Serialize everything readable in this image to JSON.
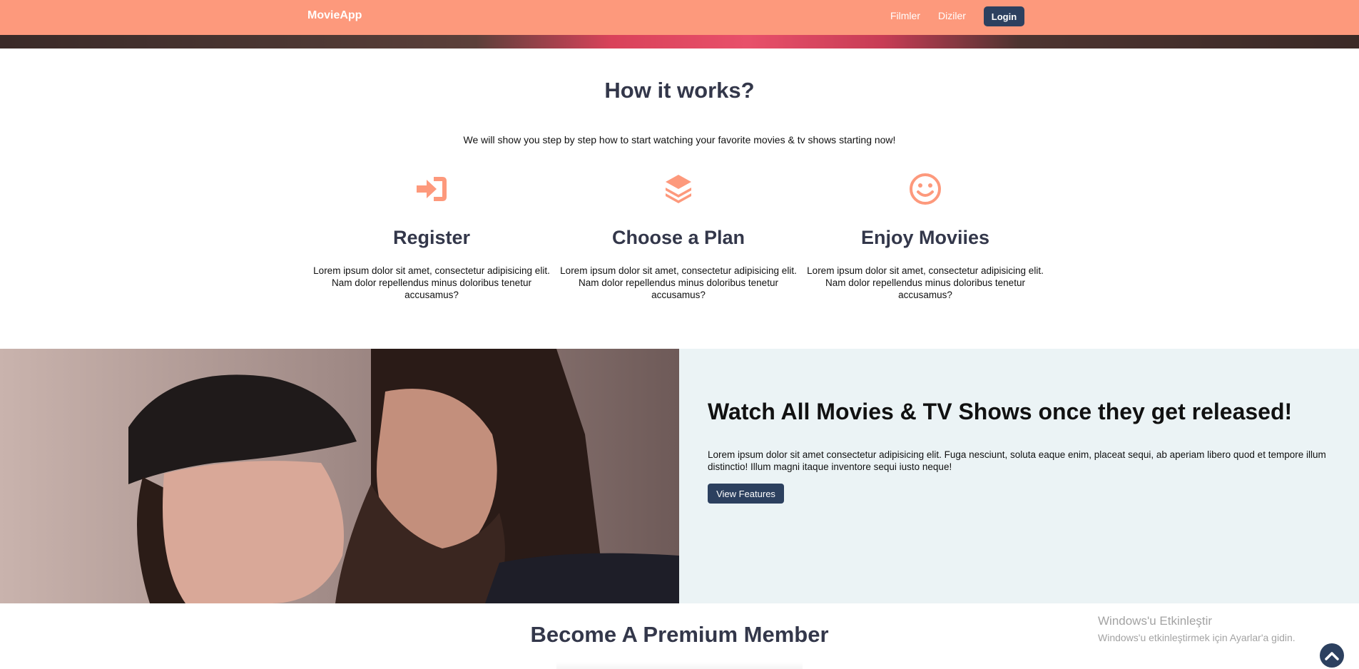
{
  "navbar": {
    "brand": "MovieApp",
    "links": [
      "Filmler",
      "Diziler"
    ],
    "login_label": "Login"
  },
  "how_it_works": {
    "title": "How it works?",
    "subtitle": "We will show you step by step how to start watching your favorite movies & tv shows starting now!",
    "steps": [
      {
        "icon": "sign-in-icon",
        "title": "Register",
        "text": "Lorem ipsum dolor sit amet, consectetur adipisicing elit. Nam dolor repellendus minus doloribus tenetur accusamus?"
      },
      {
        "icon": "layers-icon",
        "title": "Choose a Plan",
        "text": "Lorem ipsum dolor sit amet, consectetur adipisicing elit. Nam dolor repellendus minus doloribus tenetur accusamus?"
      },
      {
        "icon": "smile-icon",
        "title": "Enjoy Moviies",
        "text": "Lorem ipsum dolor sit amet, consectetur adipisicing elit. Nam dolor repellendus minus doloribus tenetur accusamus?"
      }
    ]
  },
  "feature": {
    "title": "Watch All Movies & TV Shows once they get released!",
    "text": "Lorem ipsum dolor sit amet consectetur adipisicing elit. Fuga nesciunt, soluta eaque enim, placeat sequi, ab aperiam libero quod et tempore illum distinctio! Illum magni itaque inventore sequi iusto neque!",
    "button_label": "View Features"
  },
  "premium": {
    "title": "Become A Premium Member"
  },
  "windows_watermark": {
    "title": "Windows'u Etkinleştir",
    "subtitle": "Windows'u etkinleştirmek için Ayarlar'a gidin."
  },
  "colors": {
    "accent": "#fd997c",
    "navy": "#2c405f",
    "heading": "#33374a",
    "panel": "#ebf3f5"
  }
}
